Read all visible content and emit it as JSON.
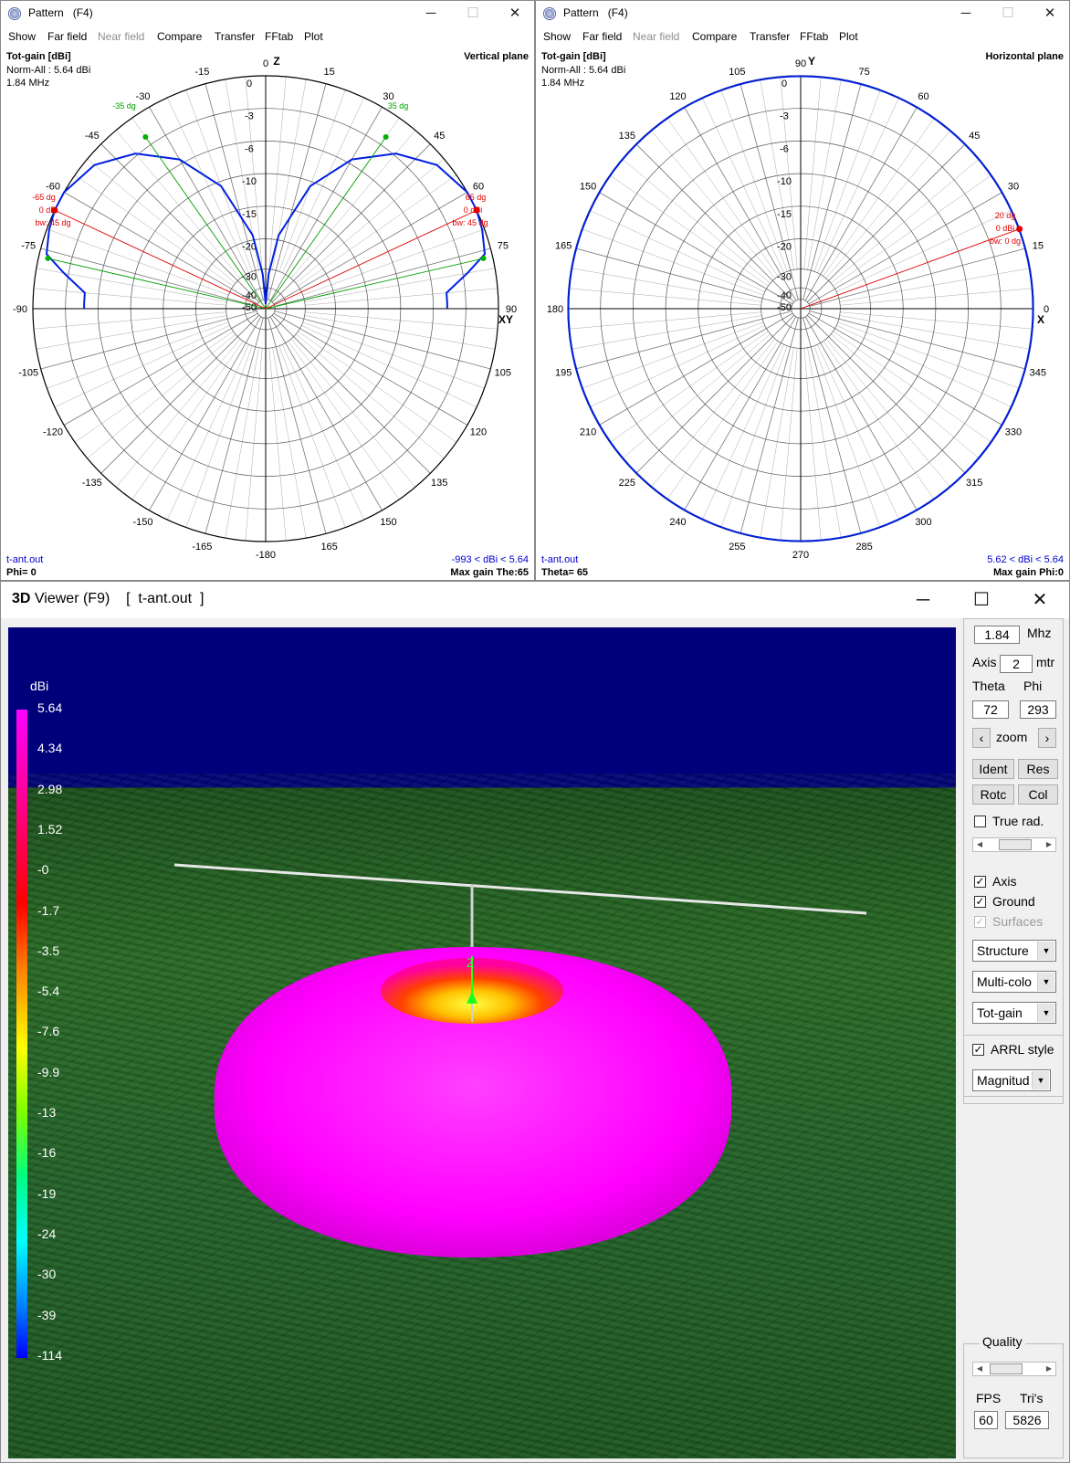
{
  "pattern_windows": [
    {
      "title": "Pattern   (F4)",
      "menu": [
        {
          "label": "Show",
          "enabled": true
        },
        {
          "label": "Far field",
          "enabled": true
        },
        {
          "label": "Near field",
          "enabled": false
        },
        {
          "label": "Compare",
          "enabled": true
        },
        {
          "label": "Transfer",
          "enabled": true
        },
        {
          "label": "FFtab",
          "enabled": true
        },
        {
          "label": "Plot",
          "enabled": true
        }
      ],
      "gain_title": "Tot-gain [dBi]",
      "norm": "Norm-All : 5.64 dBi",
      "freq": "1.84 MHz",
      "plane": "Vertical plane",
      "file": "t-ant.out",
      "angle_readout": "Phi= 0",
      "range_readout": "-993 < dBi < 5.64",
      "max_gain": "Max gain The:65",
      "axis_top": "Z",
      "axis_side": "XY",
      "angle_labels": [
        "0",
        "15",
        "30",
        "45",
        "60",
        "75",
        "90",
        "105",
        "120",
        "135",
        "150",
        "165",
        "-180",
        "-165",
        "-150",
        "-135",
        "-120",
        "-105",
        "-90",
        "-75",
        "-60",
        "-45",
        "-30",
        "-15"
      ],
      "ring_labels": [
        "0",
        "-3",
        "-6",
        "-10",
        "-15",
        "-20",
        "-30",
        "-40",
        "-50"
      ],
      "markers": {
        "left_pair": "-35 dg",
        "right_pair": "35 dg",
        "left_main": [
          "-65 dg",
          "0 dBi",
          "bw: 45 dg"
        ],
        "right_main": [
          "65 dg",
          "0 dBi",
          "bw: 45 dg"
        ]
      }
    },
    {
      "title": "Pattern   (F4)",
      "menu": [
        {
          "label": "Show",
          "enabled": true
        },
        {
          "label": "Far field",
          "enabled": true
        },
        {
          "label": "Near field",
          "enabled": false
        },
        {
          "label": "Compare",
          "enabled": true
        },
        {
          "label": "Transfer",
          "enabled": true
        },
        {
          "label": "FFtab",
          "enabled": true
        },
        {
          "label": "Plot",
          "enabled": true
        }
      ],
      "gain_title": "Tot-gain [dBi]",
      "norm": "Norm-All : 5.64 dBi",
      "freq": "1.84 MHz",
      "plane": "Horizontal plane",
      "file": "t-ant.out",
      "angle_readout": "Theta= 65",
      "range_readout": "5.62 < dBi < 5.64",
      "max_gain": "Max gain Phi:0",
      "axis_top": "Y",
      "axis_side": "X",
      "angle_labels": [
        "90",
        "75",
        "60",
        "45",
        "30",
        "15",
        "0",
        "345",
        "330",
        "315",
        "300",
        "285",
        "270",
        "255",
        "240",
        "225",
        "210",
        "195",
        "180",
        "165",
        "150",
        "135",
        "120",
        "105"
      ],
      "ring_labels": [
        "0",
        "-3",
        "-6",
        "-10",
        "-15",
        "-20",
        "-30",
        "-40",
        "-50"
      ],
      "markers": {
        "main": [
          "20 dg",
          "0 dBi",
          "bw: 0 dg"
        ]
      }
    }
  ],
  "viewer": {
    "title_prefix": "3D",
    "title_rest": " Viewer (F9)    [  t-ant.out  ]",
    "legend_unit": "dBi",
    "legend_values": [
      "5.64",
      "4.34",
      "2.98",
      "1.52",
      "-0",
      "-1.7",
      "-3.5",
      "-5.4",
      "-7.6",
      "-9.9",
      "-13",
      "-16",
      "-19",
      "-24",
      "-30",
      "-39",
      "-114"
    ],
    "axis_label": "Z",
    "colors": {
      "sky": "#00007a",
      "ground": "#2a6a26",
      "pattern": "#ff00ff"
    },
    "panel": {
      "freq": "1.84",
      "freq_unit": "Mhz",
      "axis_label": "Axis",
      "axis_value": "2",
      "axis_unit": "mtr",
      "theta_label": "Theta",
      "phi_label": "Phi",
      "theta": "72",
      "phi": "293",
      "zoom_label": "zoom",
      "buttons": [
        "Ident",
        "Res",
        "Rotc",
        "Col"
      ],
      "true_rad": {
        "label": "True rad.",
        "checked": false
      },
      "checks": [
        {
          "label": "Axis",
          "checked": true,
          "enabled": true
        },
        {
          "label": "Ground",
          "checked": true,
          "enabled": true
        },
        {
          "label": "Surfaces",
          "checked": true,
          "enabled": false
        }
      ],
      "combos": [
        "Structure",
        "Multi-colo",
        "Tot-gain"
      ],
      "arrl": {
        "label": "ARRL style",
        "checked": true
      },
      "arrl_combo": "Magnitud",
      "quality_label": "Quality",
      "fps_label": "FPS",
      "tris_label": "Tri's",
      "fps": "60",
      "tris": "5826"
    }
  }
}
